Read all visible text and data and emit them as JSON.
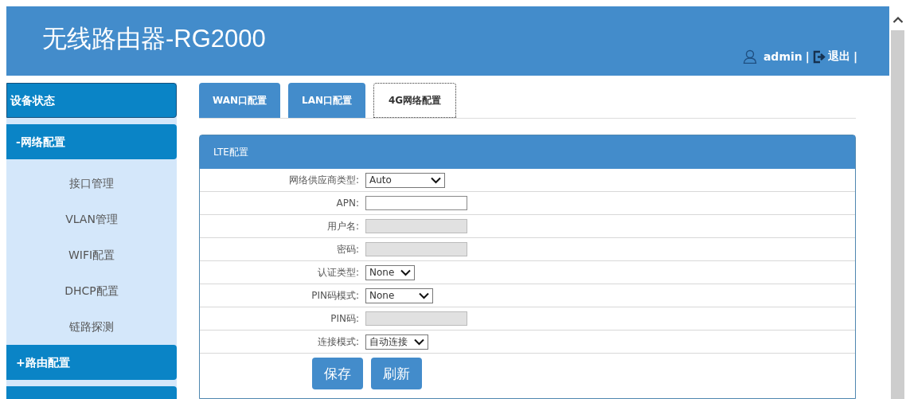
{
  "header": {
    "title": "无线路由器-RG2000",
    "user": "admin",
    "separator_1": "|",
    "logout": "退出",
    "separator_2": "|"
  },
  "sidebar": {
    "items": [
      {
        "label": "设备状态"
      },
      {
        "label": "-网络配置",
        "children": [
          {
            "label": "接口管理"
          },
          {
            "label": "VLAN管理"
          },
          {
            "label": "WIFI配置"
          },
          {
            "label": "DHCP配置"
          },
          {
            "label": "链路探测"
          }
        ]
      },
      {
        "label": "+路由配置"
      }
    ]
  },
  "tabs": [
    {
      "label": "WAN口配置",
      "selected": false
    },
    {
      "label": "LAN口配置",
      "selected": false
    },
    {
      "label": "4G网络配置",
      "selected": true
    }
  ],
  "panel": {
    "title": "LTE配置",
    "fields": [
      {
        "label": "网络供应商类型:",
        "kind": "select",
        "value": "Auto"
      },
      {
        "label": "APN:",
        "kind": "text",
        "disabled": false
      },
      {
        "label": "用户名:",
        "kind": "text",
        "disabled": true
      },
      {
        "label": "密码:",
        "kind": "text",
        "disabled": true
      },
      {
        "label": "认证类型:",
        "kind": "select",
        "value": "None"
      },
      {
        "label": "PIN码模式:",
        "kind": "select",
        "value": "None"
      },
      {
        "label": "PIN码:",
        "kind": "text",
        "disabled": true
      },
      {
        "label": "连接模式:",
        "kind": "select",
        "value": "自动连接"
      }
    ],
    "buttons": [
      "保存",
      "刷新"
    ]
  }
}
